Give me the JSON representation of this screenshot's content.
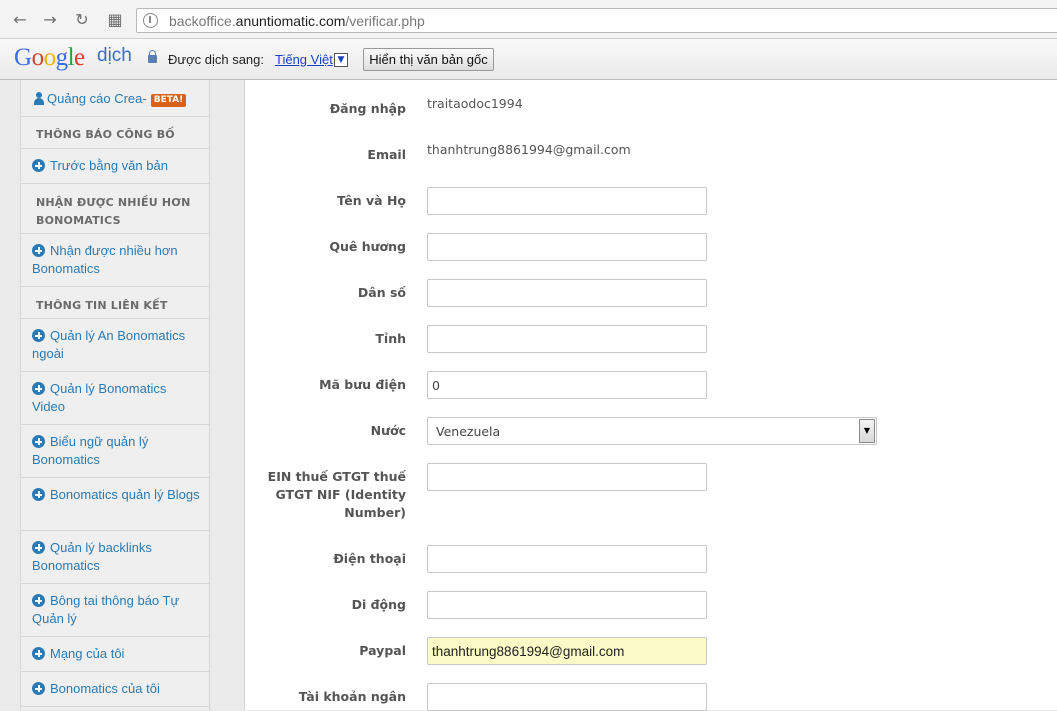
{
  "browser": {
    "url_prefix": "backoffice.",
    "url_domain": "anuntiomatic.com",
    "url_path": "/verificar.php",
    "back_icon": "←",
    "forward_icon": "→",
    "reload_icon": "↻",
    "apps_icon": "▦"
  },
  "translate_bar": {
    "logo_google": "Google",
    "logo_dich": "dịch",
    "translated_to_label": "Được dịch sang:",
    "language": "Tiếng Việt",
    "language_dropdown": "▼",
    "show_original_button": "Hiển thị văn bản gốc"
  },
  "sidebar": {
    "top_link": "Quảng cáo Crea-",
    "beta_badge": "BETA!",
    "items": [
      {
        "type": "head",
        "label": "THÔNG BÁO CÔNG BỐ"
      },
      {
        "type": "link",
        "label": "Trước bằng văn bản"
      },
      {
        "type": "head",
        "label": "NHẬN ĐƯỢC NHIỀU HƠN BONOMATICS"
      },
      {
        "type": "link",
        "label": "Nhận được nhiều hơn Bonomatics"
      },
      {
        "type": "head",
        "label": "THÔNG TIN LIÊN KẾT"
      },
      {
        "type": "link",
        "label": "Quản lý An Bonomatics ngoài"
      },
      {
        "type": "link",
        "label": "Quản lý Bonomatics Video"
      },
      {
        "type": "link",
        "label": "Biểu ngữ quản lý Bonomatics"
      },
      {
        "type": "link",
        "label": "Bonomatics quản lý Blogs"
      },
      {
        "type": "link",
        "label": "Quản lý backlinks Bonomatics"
      },
      {
        "type": "link",
        "label": "Bông tai thông báo Tự Quản lý"
      },
      {
        "type": "link",
        "label": "Mạng của tôi"
      },
      {
        "type": "link",
        "label": "Bonomatics của tôi"
      }
    ]
  },
  "form": {
    "login_label": "Đăng nhập",
    "login_value": "traitaodoc1994",
    "email_label": "Email",
    "email_value": "thanhtrung8861994@gmail.com",
    "fullname_label": "Tên và Họ",
    "fullname_value": "",
    "hometown_label": "Quê hương",
    "hometown_value": "",
    "population_label": "Dân số",
    "population_value": "",
    "province_label": "Tỉnh",
    "province_value": "",
    "postal_label": "Mã bưu điện",
    "postal_value": "0",
    "country_label": "Nước",
    "country_value": "Venezuela",
    "country_arrow": "▼",
    "ein_label_1": "EIN thuế GTGT thuế",
    "ein_label_2": "GTGT NIF (Identity",
    "ein_label_3": "Number)",
    "ein_value": "",
    "phone_label": "Điện thoại",
    "phone_value": "",
    "mobile_label": "Di động",
    "mobile_value": "",
    "paypal_label": "Paypal",
    "paypal_value": "thanhtrung8861994@gmail.com",
    "bank_label": "Tài khoản ngân",
    "bank_value": ""
  }
}
